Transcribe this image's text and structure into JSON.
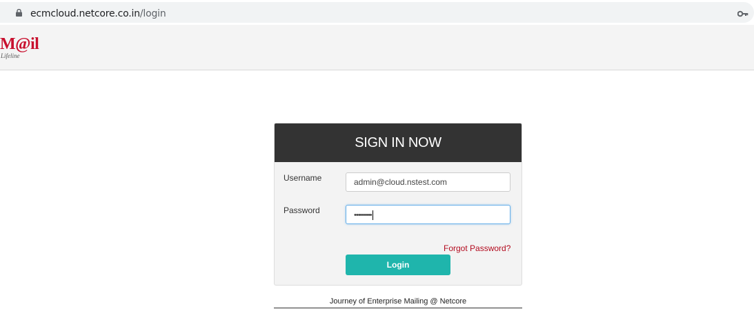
{
  "browser": {
    "url_host": "ecmcloud.netcore.co.in",
    "url_path": "/login"
  },
  "header": {
    "logo_main": "M@il",
    "logo_tagline": "Lifeline"
  },
  "login": {
    "title": "SIGN IN NOW",
    "username_label": "Username",
    "username_value": "admin@cloud.nstest.com",
    "password_label": "Password",
    "password_masked": "•••••••••",
    "forgot_label": "Forgot Password?",
    "login_label": "Login"
  },
  "footer": {
    "text": "Journey of Enterprise Mailing @ Netcore"
  },
  "colors": {
    "accent": "#1fb5ac",
    "panel_header": "#333333",
    "link": "#b30a1e",
    "logo": "#c8102e"
  }
}
